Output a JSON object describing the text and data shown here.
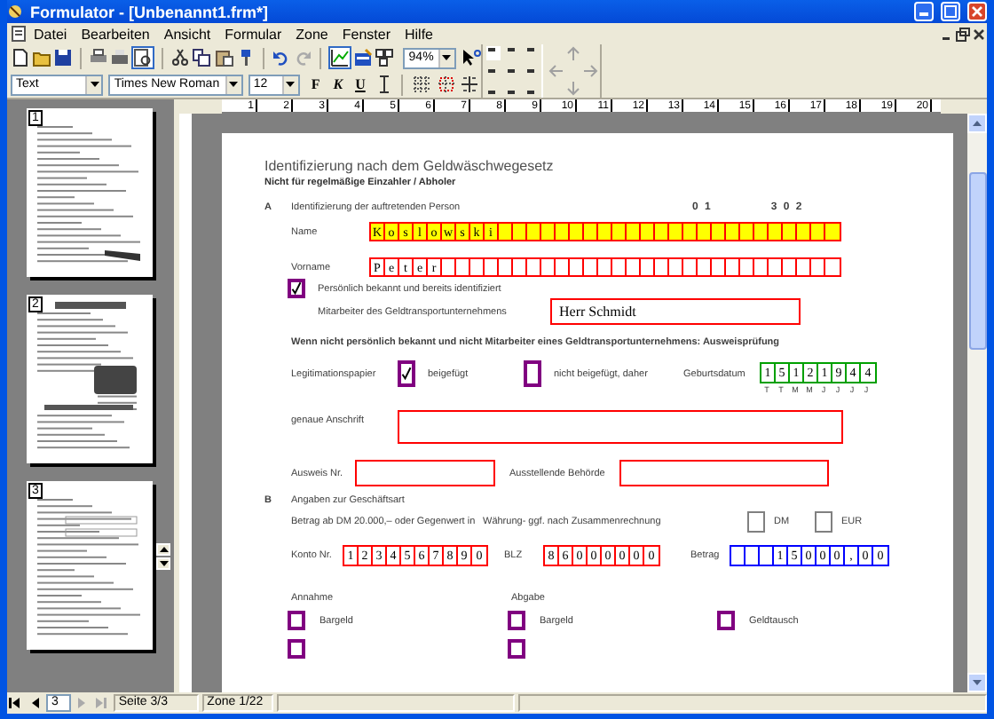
{
  "window": {
    "title": "Formulator - [Unbenannt1.frm*]"
  },
  "menu": [
    "Datei",
    "Bearbeiten",
    "Ansicht",
    "Formular",
    "Zone",
    "Fenster",
    "Hilfe"
  ],
  "toolbar": {
    "zoom": "94%",
    "style": "Text",
    "font": "Times New Roman",
    "size": "12",
    "format_buttons": [
      "F",
      "K",
      "U"
    ]
  },
  "thumbnails": [
    {
      "number": "1"
    },
    {
      "number": "2"
    },
    {
      "number": "3"
    }
  ],
  "page_nav": {
    "page": "3",
    "label": "Seite 3/3"
  },
  "status_bar": {
    "zone": "Zone 1/22"
  },
  "ruler": {
    "labels": [
      "1",
      "2",
      "3",
      "4",
      "5",
      "6",
      "7",
      "8",
      "9",
      "10",
      "11",
      "12",
      "13",
      "14",
      "15",
      "16",
      "17",
      "18",
      "19",
      "20"
    ]
  },
  "form": {
    "title": "Identifizierung nach dem Geldwäschwegesetz",
    "subtitle": "Nicht für regelmäßige Einzahler / Abholer",
    "section_a": {
      "letter": "A",
      "heading": "Identifizierung der auftretenden Person",
      "code_1": "0 1",
      "code_2": "3 0 2"
    },
    "name": {
      "label": "Name",
      "chars": [
        "K",
        "o",
        "s",
        "l",
        "o",
        "w",
        "s",
        "k",
        "i"
      ],
      "color": "#ff0000",
      "highlighted": true
    },
    "vorname": {
      "label": "Vorname",
      "chars": [
        "P",
        "e",
        "t",
        "e",
        "r"
      ],
      "color": "#ff0000",
      "highlighted": false
    },
    "known": {
      "label": "Persönlich bekannt und bereits identifiziert",
      "checked": true
    },
    "employee": {
      "label": "Mitarbeiter des Geldtransportunternehmens",
      "value": "Herr Schmidt"
    },
    "note": "Wenn nicht persönlich bekannt und nicht Mitarbeiter eines Geldtransportunternehmens: Ausweisprüfung",
    "legitimation": {
      "label": "Legitimationspapier",
      "options": [
        {
          "label": "beigefügt",
          "checked": true
        },
        {
          "label": "nicht beigefügt, daher",
          "checked": false
        }
      ]
    },
    "birth": {
      "label": "Geburtsdatum",
      "chars": [
        "1",
        "5",
        "1",
        "2",
        "1",
        "9",
        "4",
        "4"
      ],
      "color": "#00a000",
      "hints": [
        "T",
        "T",
        "M",
        "M",
        "J",
        "J",
        "J",
        "J"
      ]
    },
    "address": {
      "label": "genaue Anschrift"
    },
    "id_number": {
      "label": "Ausweis Nr."
    },
    "authority": {
      "label": "Ausstellende Behörde"
    },
    "section_b": {
      "letter": "B",
      "heading": "Angaben zur Geschäftsart"
    },
    "amount_note": "Betrag ab DM 20.000,– oder Gegenwert in",
    "currency_note": "Währung- ggf. nach Zusammenrechnung",
    "currencies": [
      {
        "label": "DM",
        "checked": false
      },
      {
        "label": "EUR",
        "checked": false
      }
    ],
    "account": {
      "label": "Konto Nr.",
      "chars": [
        "1",
        "2",
        "3",
        "4",
        "5",
        "6",
        "7",
        "8",
        "9",
        "0"
      ],
      "color": "#ff0000"
    },
    "blz": {
      "label": "BLZ",
      "chars": [
        "8",
        "6",
        "0",
        "0",
        "0",
        "0",
        "0",
        "0"
      ],
      "color": "#ff0000"
    },
    "betrag": {
      "label": "Betrag",
      "chars": [
        "1",
        "5",
        "0",
        "0",
        "0",
        ",",
        "0",
        "0"
      ],
      "color": "#0000ff"
    },
    "columns": [
      {
        "heading": "Annahme"
      },
      {
        "heading": "Abgabe"
      }
    ],
    "transactions": [
      {
        "label": "Bargeld",
        "checked": false
      },
      {
        "label": "Bargeld",
        "checked": false
      },
      {
        "label": "Geldtausch",
        "checked": false
      }
    ],
    "partial_checkboxes": [
      {
        "checked": false
      },
      {
        "checked": false
      }
    ]
  }
}
